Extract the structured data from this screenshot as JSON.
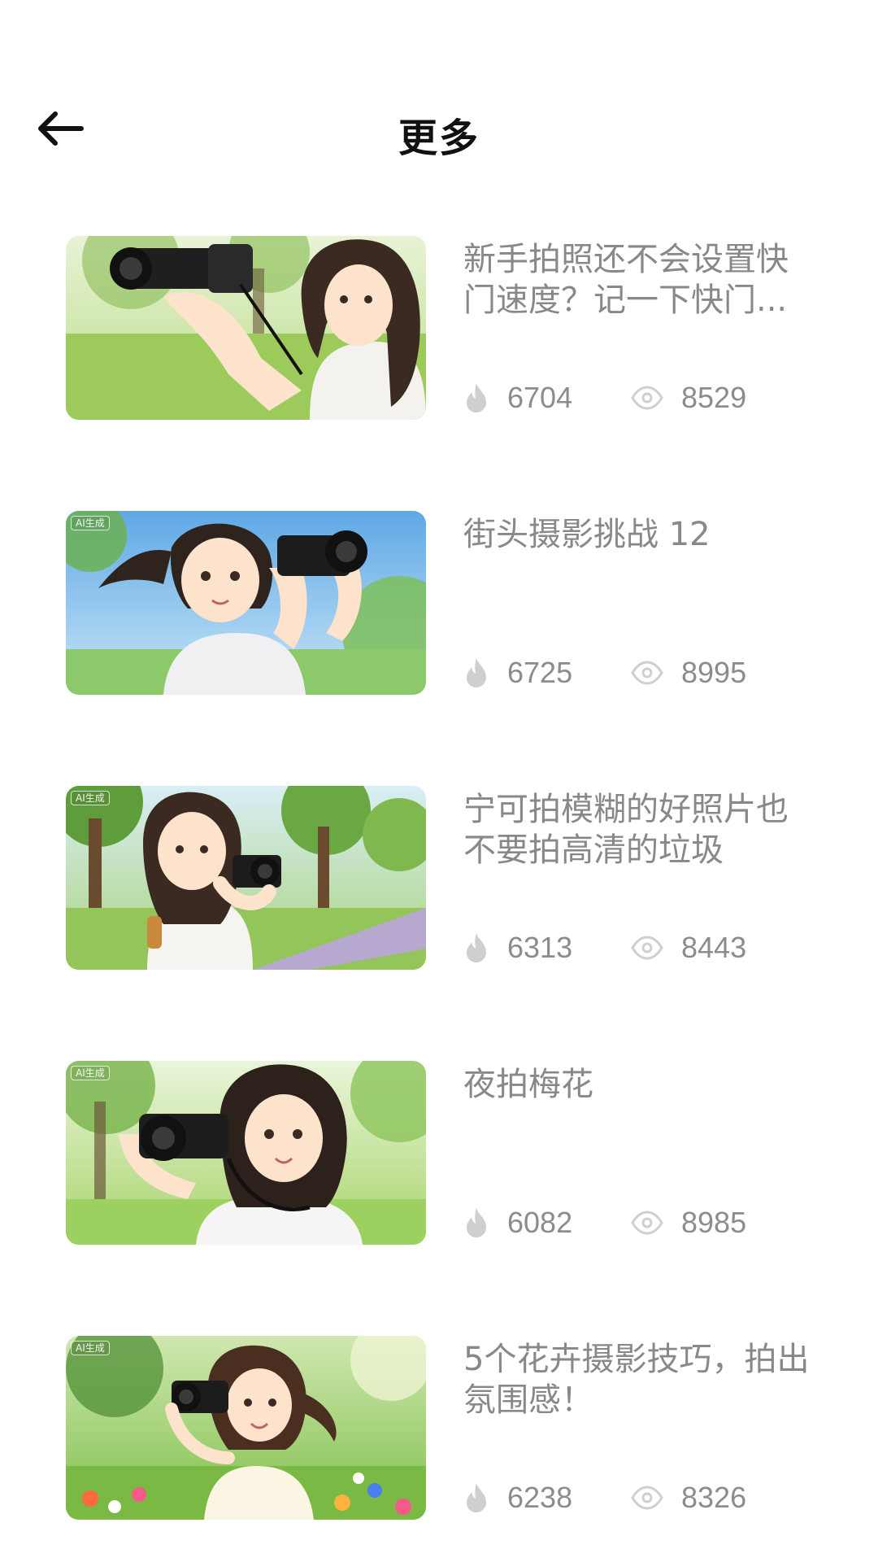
{
  "header": {
    "title": "更多"
  },
  "colors": {
    "title": "#111111",
    "item_text": "#888888",
    "stat_text": "#8c8c8c",
    "icon": "#cfcfcf"
  },
  "items": [
    {
      "title": "新手拍照还不会设置快门速度？记一下快门...",
      "hot": "6704",
      "views": "8529",
      "ai_badge": "",
      "icons": [
        "flame-icon",
        "eye-icon"
      ]
    },
    {
      "title": "街头摄影挑战 12",
      "hot": "6725",
      "views": "8995",
      "ai_badge": "AI生成",
      "icons": [
        "flame-icon",
        "eye-icon"
      ]
    },
    {
      "title": "宁可拍模糊的好照片也不要拍高清的垃圾",
      "hot": "6313",
      "views": "8443",
      "ai_badge": "AI生成",
      "icons": [
        "flame-icon",
        "eye-icon"
      ]
    },
    {
      "title": "夜拍梅花",
      "hot": "6082",
      "views": "8985",
      "ai_badge": "AI生成",
      "icons": [
        "flame-icon",
        "eye-icon"
      ]
    },
    {
      "title": "5个花卉摄影技巧，拍出氛围感！",
      "hot": "6238",
      "views": "8326",
      "ai_badge": "AI生成",
      "icons": [
        "flame-icon",
        "eye-icon"
      ]
    }
  ]
}
